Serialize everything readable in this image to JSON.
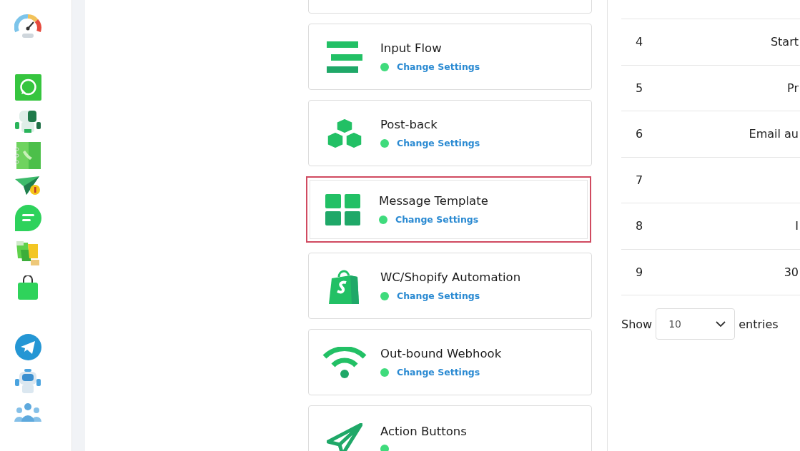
{
  "sidebar": {
    "items": [
      {
        "kind": "gauge"
      },
      {
        "kind": "whatsapp"
      },
      {
        "kind": "robot"
      },
      {
        "kind": "contacts"
      },
      {
        "kind": "plane"
      },
      {
        "kind": "chat"
      },
      {
        "kind": "puzzle"
      },
      {
        "kind": "bag"
      },
      {
        "kind": "telegram"
      },
      {
        "kind": "bluebot"
      },
      {
        "kind": "people"
      }
    ]
  },
  "cards": [
    {
      "kind": "lines",
      "title": "Input Flow",
      "link": "Change Settings",
      "selected": false
    },
    {
      "kind": "cubes",
      "title": "Post-back",
      "link": "Change Settings",
      "selected": false
    },
    {
      "kind": "grid",
      "title": "Message Template",
      "link": "Change Settings",
      "selected": true
    },
    {
      "kind": "shopify",
      "title": "WC/Shopify Automation",
      "link": "Change Settings",
      "selected": false
    },
    {
      "kind": "wifi",
      "title": "Out-bound Webhook",
      "link": "Change Settings",
      "selected": false
    },
    {
      "kind": "send",
      "title": "Action Buttons",
      "selected": false
    }
  ],
  "table": {
    "rows": [
      {
        "number": "4",
        "column_2": "Start"
      },
      {
        "number": "5",
        "column_2": "Pr"
      },
      {
        "number": "6",
        "column_2": "Email au"
      },
      {
        "number": "7"
      },
      {
        "number": "8",
        "column_2": "I"
      },
      {
        "number": "9",
        "column_2": "30"
      }
    ]
  },
  "entries": {
    "before": "Show",
    "value": "10",
    "after": "entries"
  }
}
